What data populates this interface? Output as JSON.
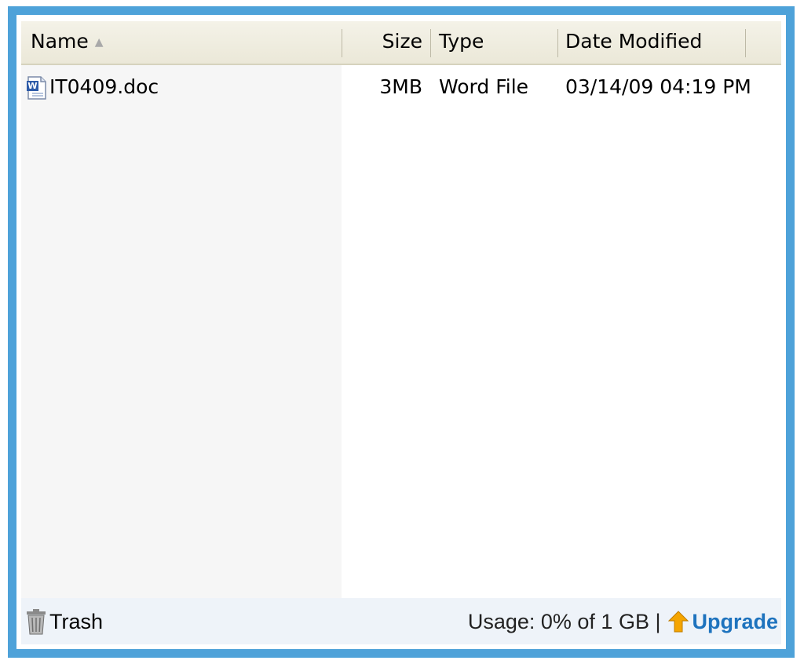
{
  "columns": {
    "name": "Name",
    "size": "Size",
    "type": "Type",
    "date": "Date Modified"
  },
  "files": [
    {
      "name": "IT0409.doc",
      "size": "3MB",
      "type": "Word File",
      "date": "03/14/09 04:19 PM",
      "icon": "word-doc-icon"
    }
  ],
  "footer": {
    "trash_label": "Trash",
    "usage_text": "Usage: 0% of 1 GB |",
    "upgrade_label": "Upgrade"
  },
  "colors": {
    "frame_border": "#4ea2d9",
    "link": "#1e73be",
    "upgrade_arrow": "#f5a500"
  }
}
